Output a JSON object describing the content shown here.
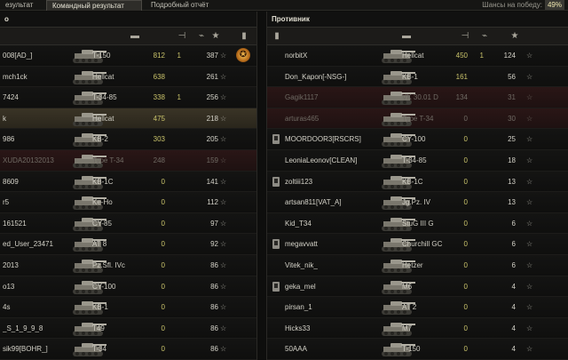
{
  "tabs": [
    "езультат",
    "Командный результат",
    "Подробный отчёт"
  ],
  "win_chance": {
    "label": "Шансы на победу:",
    "value": "49%"
  },
  "left_team": {
    "title": "о",
    "header_icons": [
      "vehicle-icon",
      "frags-icon",
      "spotted-icon",
      "xp-star-icon",
      "platoon-icon"
    ],
    "rows": [
      {
        "player": "008[AD_]",
        "tank": "T-150",
        "damage": "812",
        "kills": "1",
        "xp": "387",
        "state": "normal",
        "medal": true
      },
      {
        "player": "mch1ck",
        "tank": "Hellcat",
        "damage": "638",
        "kills": "",
        "xp": "261",
        "state": "normal"
      },
      {
        "player": "7424",
        "tank": "T-34-85",
        "damage": "338",
        "kills": "1",
        "xp": "256",
        "state": "normal"
      },
      {
        "player": "k",
        "tank": "Hellcat",
        "damage": "475",
        "kills": "",
        "xp": "218",
        "state": "highlight"
      },
      {
        "player": "986",
        "tank": "KB-2",
        "damage": "303",
        "kills": "",
        "xp": "205",
        "state": "normal"
      },
      {
        "player": "XUDA20132013",
        "tank": "Type T-34",
        "damage": "248",
        "kills": "",
        "xp": "159",
        "state": "dead"
      },
      {
        "player": "8609",
        "tank": "KB-1C",
        "damage": "0",
        "kills": "",
        "xp": "141",
        "state": "normal"
      },
      {
        "player": "r5",
        "tank": "Ke-Ho",
        "damage": "0",
        "kills": "",
        "xp": "112",
        "state": "normal"
      },
      {
        "player": "161521",
        "tank": "CY-85",
        "damage": "0",
        "kills": "",
        "xp": "97",
        "state": "normal"
      },
      {
        "player": "ed_User_23471",
        "tank": "AT 8",
        "damage": "0",
        "kills": "",
        "xp": "92",
        "state": "normal"
      },
      {
        "player": "2013",
        "tank": "Pz.Sfl. IVc",
        "damage": "0",
        "kills": "",
        "xp": "86",
        "state": "normal"
      },
      {
        "player": "o13",
        "tank": "CY-100",
        "damage": "0",
        "kills": "",
        "xp": "86",
        "state": "normal"
      },
      {
        "player": "4s",
        "tank": "KB-1",
        "damage": "0",
        "kills": "",
        "xp": "86",
        "state": "normal"
      },
      {
        "player": "_S_1_9_9_8",
        "tank": "T49",
        "damage": "0",
        "kills": "",
        "xp": "86",
        "state": "normal"
      },
      {
        "player": "sik99[BOHR_]",
        "tank": "T-34",
        "damage": "0",
        "kills": "",
        "xp": "86",
        "state": "normal"
      }
    ]
  },
  "right_team": {
    "title": "Противник",
    "header_icons": [
      "platoon-icon",
      "vehicle-icon",
      "frags-icon",
      "spotted-icon",
      "xp-star-icon"
    ],
    "rows": [
      {
        "player": "norbitX",
        "tank": "Hellcat",
        "damage": "450",
        "kills": "1",
        "xp": "124",
        "state": "normal",
        "platoon": false
      },
      {
        "player": "Don_Kapon[-NSG-]",
        "tank": "KB-1",
        "damage": "161",
        "kills": "",
        "xp": "56",
        "state": "normal",
        "platoon": false
      },
      {
        "player": "Gagik1117",
        "tank": "VK 30.01 D",
        "damage": "134",
        "kills": "",
        "xp": "31",
        "state": "dead",
        "platoon": false
      },
      {
        "player": "arturas465",
        "tank": "Type T-34",
        "damage": "0",
        "kills": "",
        "xp": "30",
        "state": "dead",
        "platoon": false
      },
      {
        "player": "MOORDOOR3[RSCRS]",
        "tank": "CY-100",
        "damage": "0",
        "kills": "",
        "xp": "25",
        "state": "normal",
        "platoon": true
      },
      {
        "player": "LeoniaLeonov[CLEAN]",
        "tank": "T-34-85",
        "damage": "0",
        "kills": "",
        "xp": "18",
        "state": "normal",
        "platoon": false
      },
      {
        "player": "zoltiii123",
        "tank": "KB-1C",
        "damage": "0",
        "kills": "",
        "xp": "13",
        "state": "normal",
        "platoon": true
      },
      {
        "player": "artsan811[VAT_A]",
        "tank": "Jg.Pz. IV",
        "damage": "0",
        "kills": "",
        "xp": "13",
        "state": "normal",
        "platoon": false
      },
      {
        "player": "Kid_T34",
        "tank": "StuG III G",
        "damage": "0",
        "kills": "",
        "xp": "6",
        "state": "normal",
        "platoon": false
      },
      {
        "player": "megavvatt",
        "tank": "Churchill GC",
        "damage": "0",
        "kills": "",
        "xp": "6",
        "state": "normal",
        "platoon": true
      },
      {
        "player": "Vitek_nik_",
        "tank": "Hetzer",
        "damage": "0",
        "kills": "",
        "xp": "6",
        "state": "normal",
        "platoon": false
      },
      {
        "player": "geka_mel",
        "tank": "M6",
        "damage": "0",
        "kills": "",
        "xp": "4",
        "state": "normal",
        "platoon": true
      },
      {
        "player": "pirsan_1",
        "tank": "AT 2",
        "damage": "0",
        "kills": "",
        "xp": "4",
        "state": "normal",
        "platoon": false
      },
      {
        "player": "Hicks33",
        "tank": "M7",
        "damage": "0",
        "kills": "",
        "xp": "4",
        "state": "normal",
        "platoon": false
      },
      {
        "player": "50AAA",
        "tank": "T-150",
        "damage": "0",
        "kills": "",
        "xp": "4",
        "state": "normal",
        "platoon": false
      }
    ]
  },
  "icons": {
    "star": "☆"
  }
}
